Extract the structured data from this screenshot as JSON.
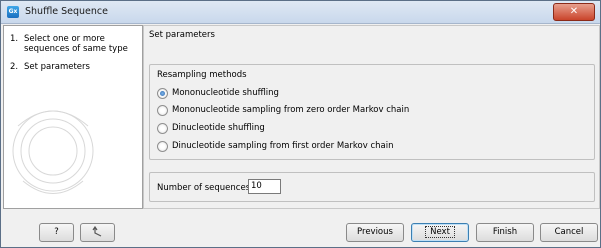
{
  "window": {
    "title": "Shuffle Sequence",
    "app_icon_text": "Gx",
    "close_symbol": "✕"
  },
  "steps": [
    {
      "num": "1.",
      "label": "Select one or more sequences of same type"
    },
    {
      "num": "2.",
      "label": "Set parameters"
    }
  ],
  "main": {
    "section_label": "Set parameters",
    "resampling": {
      "title": "Resampling methods",
      "options": [
        {
          "label": "Mononucleotide shuffling",
          "checked": true
        },
        {
          "label": "Mononucleotide sampling from zero order Markov chain",
          "checked": false
        },
        {
          "label": "Dinucleotide shuffling",
          "checked": false
        },
        {
          "label": "Dinucleotide sampling from first order Markov chain",
          "checked": false
        }
      ]
    },
    "num_sequences": {
      "label": "Number of sequences:",
      "value": "10"
    }
  },
  "buttons": {
    "help": "?",
    "previous": "Previous",
    "next": "Next",
    "finish": "Finish",
    "cancel": "Cancel"
  },
  "icons": {
    "help": "help-icon",
    "reset": "reset-arrow-icon"
  }
}
